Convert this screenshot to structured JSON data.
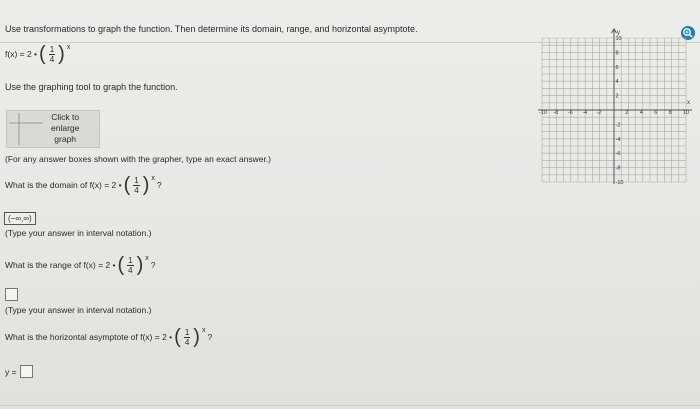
{
  "question": {
    "instruction": "Use transformations to graph the function. Then determine its domain, range, and horizontal asymptote.",
    "func_label": "f(x) = 2 •",
    "fraction_num": "1",
    "fraction_den": "4",
    "exponent": "x"
  },
  "tool": {
    "instruction": "Use the graphing tool to graph the function.",
    "button_label_1": "Click to",
    "button_label_2": "enlarge",
    "button_label_3": "graph",
    "note": "(For any answer boxes shown with the grapher, type an exact answer.)"
  },
  "domain": {
    "question": "What is the domain of f(x) = 2 •",
    "answer": "(−∞,∞)",
    "hint": "(Type your answer in interval notation.)",
    "end": "?"
  },
  "range": {
    "question": "What is the range of f(x) = 2 •",
    "hint": "(Type your answer in interval notation.)",
    "end": "?"
  },
  "asymptote": {
    "question": "What is the horizontal asymptote of f(x) = 2 •",
    "prefix": "y =",
    "end": "?"
  },
  "graph": {
    "y_axis_label": "y",
    "x_axis_label": "x",
    "x_ticks": [
      "-10",
      "-8",
      "-6",
      "-4",
      "-2",
      "2",
      "4",
      "6",
      "8",
      "10"
    ],
    "y_ticks": [
      "10",
      "8",
      "6",
      "4",
      "2",
      "-2",
      "-4",
      "-6",
      "-8",
      "-10"
    ]
  },
  "colors": {
    "accent": "#1b7fb3",
    "grid": "#a9a9a4",
    "axis": "#555555"
  }
}
